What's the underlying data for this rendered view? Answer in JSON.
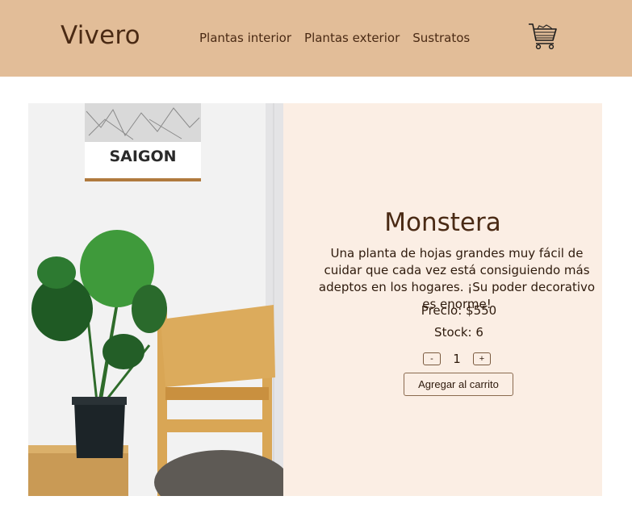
{
  "brand": "Vivero",
  "nav": {
    "links": [
      "Plantas interior",
      "Plantas exterior",
      "Sustratos"
    ],
    "cart_icon": "cart-icon"
  },
  "product": {
    "image_text": "SAIGON",
    "title": "Monstera",
    "description": "Una planta de hojas grandes muy fácil de cuidar que cada vez está consiguiendo más adeptos en los hogares. ¡Su poder decorativo es enorme!",
    "price_text": "Precio: $550",
    "stock_text": "Stock: 6",
    "quantity": "1",
    "decrement_label": "-",
    "increment_label": "+",
    "add_to_cart_label": "Agregar al carrito"
  },
  "colors": {
    "navbar_bg": "#e2bd98",
    "card_bg": "#fbeee4",
    "text_brown": "#4a2a14"
  }
}
